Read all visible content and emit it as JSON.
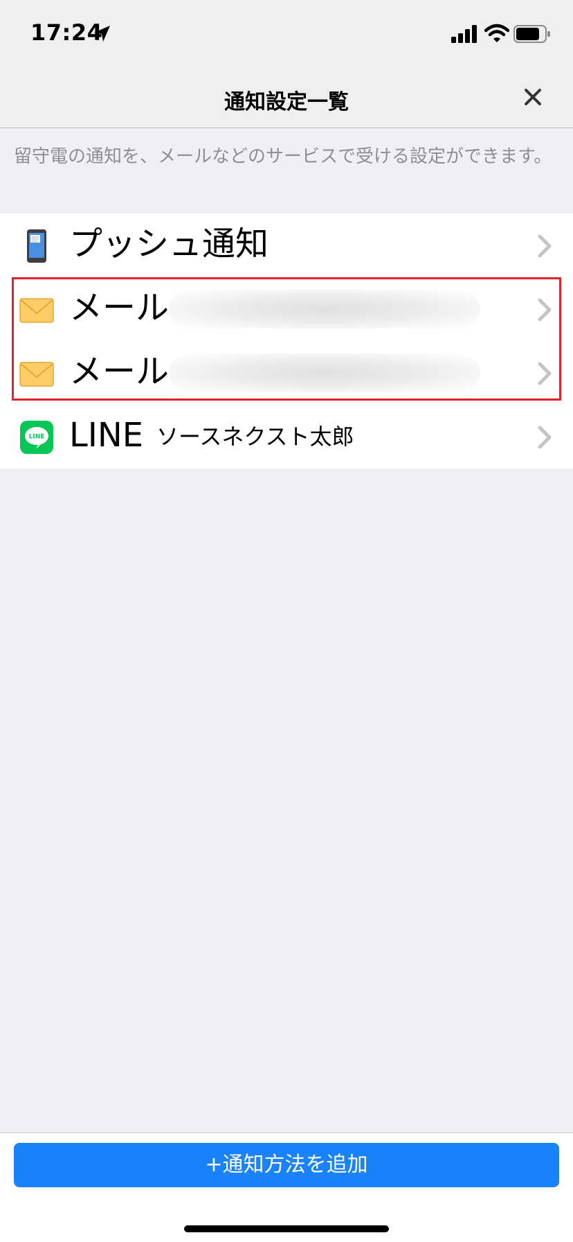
{
  "status_bar": {
    "time": "17:24"
  },
  "nav": {
    "title": "通知設定一覧",
    "close_icon": "close-icon"
  },
  "description": "留守電の通知を、メールなどのサービスで受ける設定ができます。",
  "rows": [
    {
      "icon": "phone-icon",
      "label": "プッシュ通知",
      "sub": ""
    },
    {
      "icon": "mail-icon",
      "label": "メール",
      "sub": ""
    },
    {
      "icon": "mail-icon",
      "label": "メール",
      "sub": ""
    },
    {
      "icon": "line-icon",
      "label": "LINE",
      "sub": "ソースネクスト太郎"
    }
  ],
  "line_icon_text": "LINE",
  "add_button": "+通知方法を追加",
  "colors": {
    "accent": "#1a82fb",
    "highlight": "#e0242a",
    "line_green": "#06c755"
  }
}
